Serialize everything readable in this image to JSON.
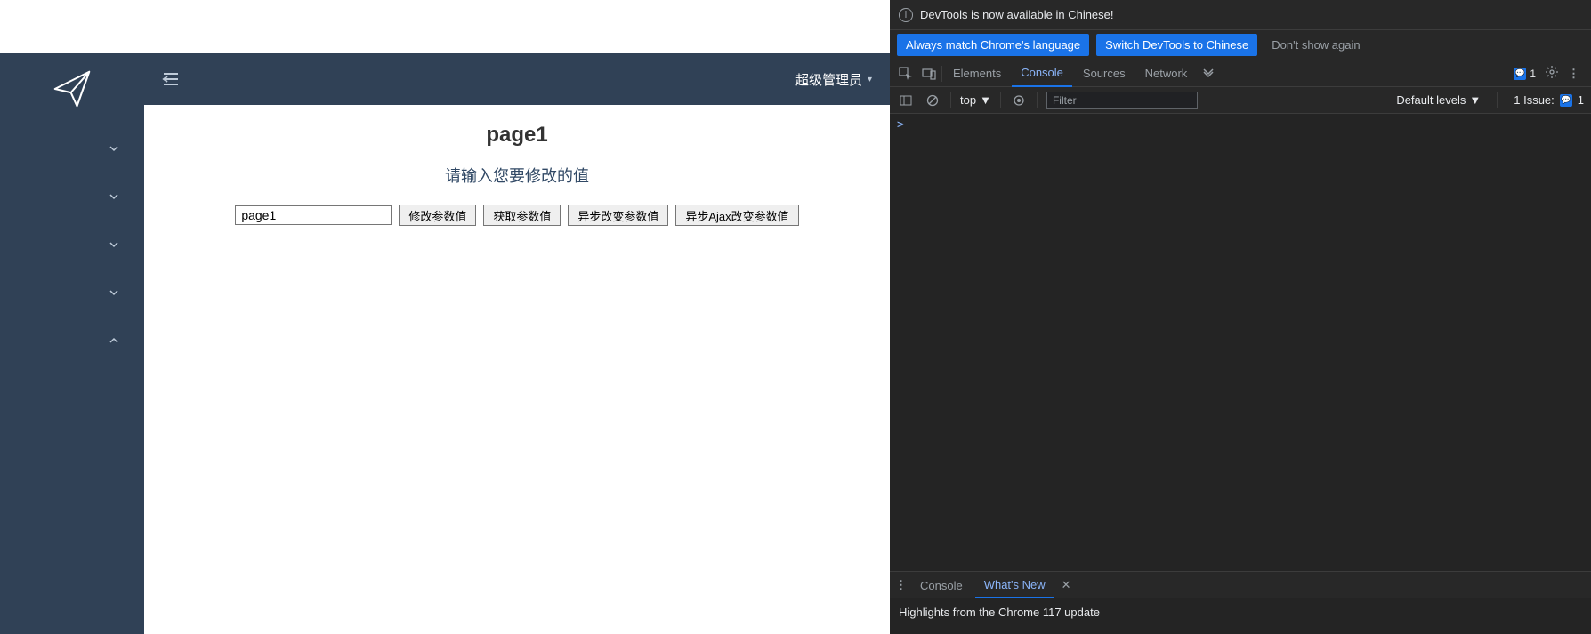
{
  "app": {
    "user_label": "超级管理员",
    "page_title": "page1",
    "prompt_text": "请输入您要修改的值",
    "input_value": "page1",
    "buttons": {
      "b1": "修改参数值",
      "b2": "获取参数值",
      "b3": "异步改变参数值",
      "b4": "异步Ajax改变参数值"
    },
    "sidebar": {
      "items": [
        {
          "expanded": false
        },
        {
          "expanded": false
        },
        {
          "expanded": false
        },
        {
          "expanded": false
        },
        {
          "expanded": true
        }
      ]
    }
  },
  "devtools": {
    "banner1_text": "DevTools is now available in Chinese!",
    "banner2": {
      "btn1": "Always match Chrome's language",
      "btn2": "Switch DevTools to Chinese",
      "btn3": "Don't show again"
    },
    "tabs": {
      "elements": "Elements",
      "console": "Console",
      "sources": "Sources",
      "network": "Network"
    },
    "messages_count": "1",
    "filter": {
      "context": "top",
      "placeholder": "Filter",
      "levels": "Default levels",
      "issues_label": "1 Issue:",
      "issues_count": "1"
    },
    "prompt": ">",
    "drawer": {
      "tab_console": "Console",
      "tab_whatsnew": "What's New",
      "body_text": "Highlights from the Chrome 117 update"
    }
  }
}
